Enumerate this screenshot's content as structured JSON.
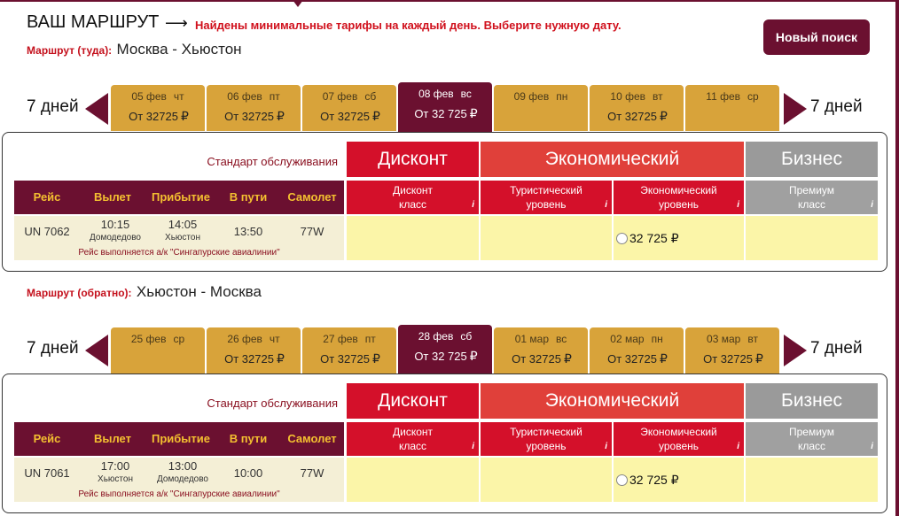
{
  "header": {
    "title": "ВАШ МАРШРУТ",
    "arrow": "⟶",
    "message": "Найдены минимальные тарифы на каждый день. Выберите нужную дату.",
    "new_search": "Новый поиск"
  },
  "outbound": {
    "label": "Маршрут (туда):",
    "route": "Москва - Хьюстон",
    "days_prev": "7 дней",
    "days_next": "7 дней",
    "dates": [
      {
        "date": "05 фев",
        "wd": "чт",
        "price": "От 32725",
        "cur": "₽",
        "selected": false
      },
      {
        "date": "06 фев",
        "wd": "пт",
        "price": "От 32725",
        "cur": "₽",
        "selected": false
      },
      {
        "date": "07 фев",
        "wd": "сб",
        "price": "От 32725",
        "cur": "₽",
        "selected": false
      },
      {
        "date": "08 фев",
        "wd": "вс",
        "price": "От 32 725",
        "cur": "₽",
        "selected": true
      },
      {
        "date": "09 фев",
        "wd": "пн",
        "price": "",
        "cur": "",
        "selected": false
      },
      {
        "date": "10 фев",
        "wd": "вт",
        "price": "От 32725",
        "cur": "₽",
        "selected": false
      },
      {
        "date": "11 фев",
        "wd": "ср",
        "price": "",
        "cur": "",
        "selected": false
      }
    ],
    "service_label": "Стандарт обслуживания",
    "classes": {
      "discount": "Дисконт",
      "economy": "Экономический",
      "business": "Бизнес"
    },
    "columns": [
      "Рейс",
      "Вылет",
      "Прибытие",
      "В пути",
      "Самолет"
    ],
    "subclasses": [
      {
        "line1": "Дисконт",
        "line2": "класс",
        "info": "i"
      },
      {
        "line1": "Туристический",
        "line2": "уровень",
        "info": "i"
      },
      {
        "line1": "Экономический",
        "line2": "уровень",
        "info": "i"
      },
      {
        "line1": "Премиум",
        "line2": "класс",
        "info": "i"
      }
    ],
    "flight": {
      "number": "UN 7062",
      "dep_time": "10:15",
      "dep_place": "Домодедово",
      "arr_time": "14:05",
      "arr_place": "Хьюстон",
      "duration": "13:50",
      "aircraft": "77W",
      "operator": "Рейс выполняется а/к \"Сингапурские авиалинии\"",
      "fare_price": "32 725 ₽"
    }
  },
  "inbound": {
    "label": "Маршрут (обратно):",
    "route": "Хьюстон - Москва",
    "days_prev": "7 дней",
    "days_next": "7 дней",
    "dates": [
      {
        "date": "25 фев",
        "wd": "ср",
        "price": "",
        "cur": "",
        "selected": false
      },
      {
        "date": "26 фев",
        "wd": "чт",
        "price": "От 32725",
        "cur": "₽",
        "selected": false
      },
      {
        "date": "27 фев",
        "wd": "пт",
        "price": "От 32725",
        "cur": "₽",
        "selected": false
      },
      {
        "date": "28 фев",
        "wd": "сб",
        "price": "От 32 725",
        "cur": "₽",
        "selected": true
      },
      {
        "date": "01 мар",
        "wd": "вс",
        "price": "От 32725",
        "cur": "₽",
        "selected": false
      },
      {
        "date": "02 мар",
        "wd": "пн",
        "price": "От 32725",
        "cur": "₽",
        "selected": false
      },
      {
        "date": "03 мар",
        "wd": "вт",
        "price": "От 32725",
        "cur": "₽",
        "selected": false
      }
    ],
    "service_label": "Стандарт обслуживания",
    "classes": {
      "discount": "Дисконт",
      "economy": "Экономический",
      "business": "Бизнес"
    },
    "columns": [
      "Рейс",
      "Вылет",
      "Прибытие",
      "В пути",
      "Самолет"
    ],
    "subclasses": [
      {
        "line1": "Дисконт",
        "line2": "класс",
        "info": "i"
      },
      {
        "line1": "Туристический",
        "line2": "уровень",
        "info": "i"
      },
      {
        "line1": "Экономический",
        "line2": "уровень",
        "info": "i"
      },
      {
        "line1": "Премиум",
        "line2": "класс",
        "info": "i"
      }
    ],
    "flight": {
      "number": "UN 7061",
      "dep_time": "17:00",
      "dep_place": "Хьюстон",
      "arr_time": "13:00",
      "arr_place": "Домодедово",
      "duration": "10:00",
      "aircraft": "77W",
      "operator": "Рейс выполняется а/к \"Сингапурские авиалинии\"",
      "fare_price": "32 725 ₽"
    }
  },
  "colors": {
    "brand": "#6b1030",
    "date_tab": "#d8a33a",
    "discount": "#d4102a",
    "economy": "#e0403a",
    "business": "#9a9a9a",
    "fare_bg": "#fbf5a8"
  }
}
